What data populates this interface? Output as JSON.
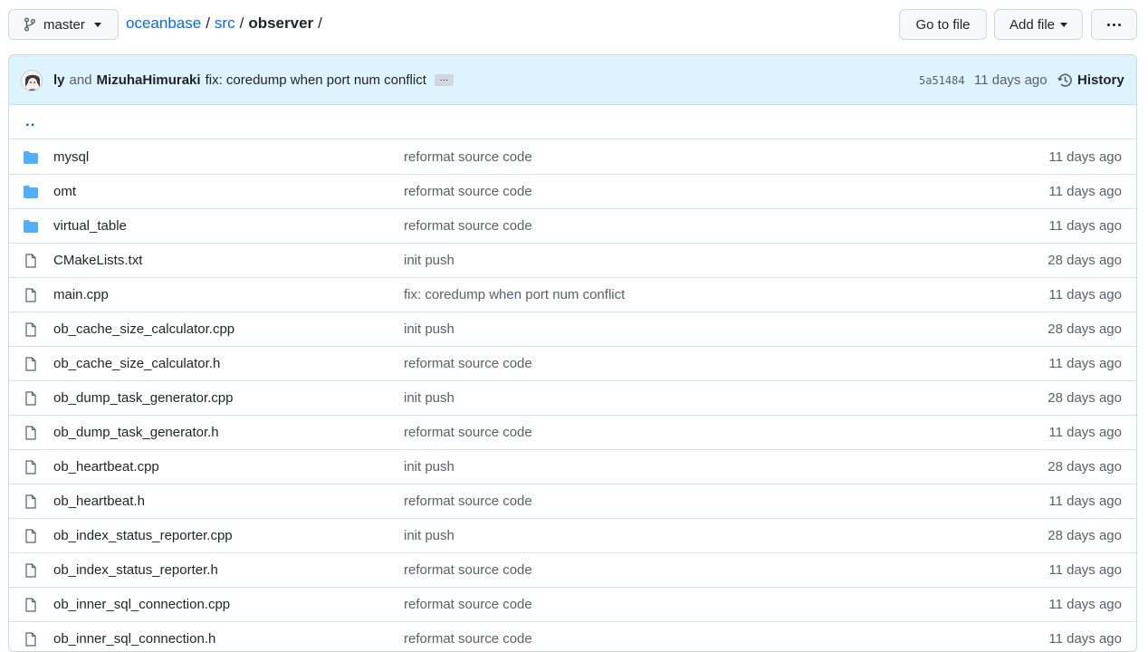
{
  "branch": {
    "label": "master",
    "icon": "git-branch-icon"
  },
  "breadcrumb": {
    "repo": "oceanbase",
    "dir": "src",
    "current": "observer",
    "sep": "/"
  },
  "actions": {
    "go_to_file": "Go to file",
    "add_file": "Add file",
    "more": "more-icon"
  },
  "commit": {
    "author1": "ly",
    "and": "and",
    "author2": "MizuhaHimuraki",
    "message": "fix: coredump when port num conflict",
    "ellipsis": "…",
    "sha": "5a51484",
    "age": "11 days ago",
    "history_label": "History"
  },
  "parent_link": "..",
  "colors": {
    "link": "#0969da",
    "folder": "#54aeff",
    "commit_bg": "#ddf4ff",
    "muted": "#57606a"
  },
  "files": [
    {
      "type": "dir",
      "name": "mysql",
      "message": "reformat source code",
      "age": "11 days ago"
    },
    {
      "type": "dir",
      "name": "omt",
      "message": "reformat source code",
      "age": "11 days ago"
    },
    {
      "type": "dir",
      "name": "virtual_table",
      "message": "reformat source code",
      "age": "11 days ago"
    },
    {
      "type": "file",
      "name": "CMakeLists.txt",
      "message": "init push",
      "age": "28 days ago"
    },
    {
      "type": "file",
      "name": "main.cpp",
      "message": "fix: coredump when port num conflict",
      "age": "11 days ago"
    },
    {
      "type": "file",
      "name": "ob_cache_size_calculator.cpp",
      "message": "init push",
      "age": "28 days ago"
    },
    {
      "type": "file",
      "name": "ob_cache_size_calculator.h",
      "message": "reformat source code",
      "age": "11 days ago"
    },
    {
      "type": "file",
      "name": "ob_dump_task_generator.cpp",
      "message": "init push",
      "age": "28 days ago"
    },
    {
      "type": "file",
      "name": "ob_dump_task_generator.h",
      "message": "reformat source code",
      "age": "11 days ago"
    },
    {
      "type": "file",
      "name": "ob_heartbeat.cpp",
      "message": "init push",
      "age": "28 days ago"
    },
    {
      "type": "file",
      "name": "ob_heartbeat.h",
      "message": "reformat source code",
      "age": "11 days ago"
    },
    {
      "type": "file",
      "name": "ob_index_status_reporter.cpp",
      "message": "init push",
      "age": "28 days ago"
    },
    {
      "type": "file",
      "name": "ob_index_status_reporter.h",
      "message": "reformat source code",
      "age": "11 days ago"
    },
    {
      "type": "file",
      "name": "ob_inner_sql_connection.cpp",
      "message": "reformat source code",
      "age": "11 days ago"
    },
    {
      "type": "file",
      "name": "ob_inner_sql_connection.h",
      "message": "reformat source code",
      "age": "11 days ago"
    }
  ]
}
